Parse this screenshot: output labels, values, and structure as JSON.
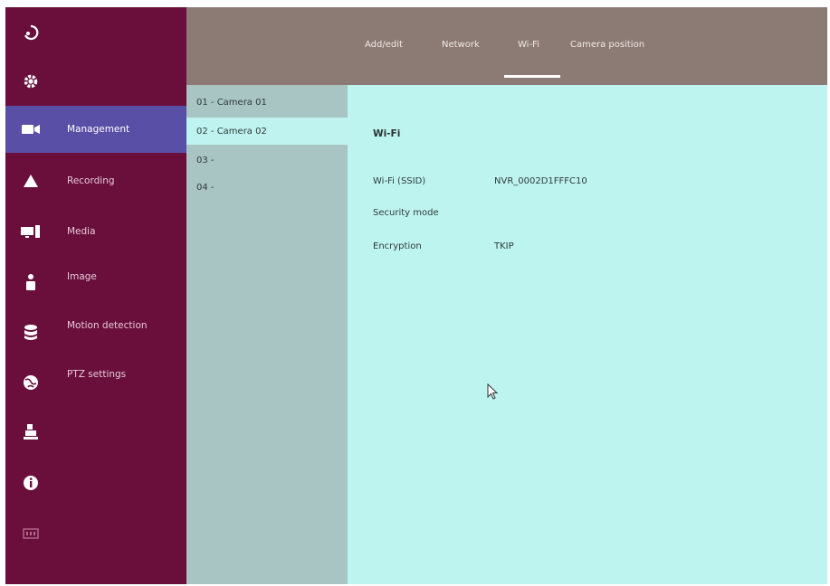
{
  "rail": {
    "icons": [
      "playback-icon",
      "gear-icon",
      "camera-icon",
      "alert-icon",
      "display-devices-icon",
      "person-icon",
      "database-icon",
      "network-globe-icon",
      "printer-icon",
      "info-icon",
      "storage-icon"
    ],
    "active_index": 2
  },
  "menu": {
    "items": [
      {
        "label": "Management",
        "active": true
      },
      {
        "label": "Recording",
        "active": false
      },
      {
        "label": "Media",
        "active": false
      },
      {
        "label": "Image",
        "active": false
      },
      {
        "label": "Motion detection",
        "active": false
      },
      {
        "label": "PTZ settings",
        "active": false
      }
    ]
  },
  "tabs": [
    {
      "label": "Add/edit",
      "active": false
    },
    {
      "label": "Network",
      "active": false
    },
    {
      "label": "Wi-Fi",
      "active": true
    },
    {
      "label": "Camera position",
      "active": false
    }
  ],
  "cameras": [
    {
      "label": "01 - Camera 01",
      "selected": false
    },
    {
      "label": "02 - Camera 02",
      "selected": true
    },
    {
      "label": "03 -",
      "selected": false
    },
    {
      "label": "04 -",
      "selected": false
    }
  ],
  "wifi": {
    "title": "Wi-Fi",
    "fields": [
      {
        "label": "Wi-Fi (SSID)",
        "value": "NVR_0002D1FFFC10"
      },
      {
        "label": "Security mode",
        "value": ""
      },
      {
        "label": "Encryption",
        "value": "TKIP"
      }
    ]
  },
  "colors": {
    "sidebar": "#6a0f3c",
    "active": "#5a4fa6",
    "topbar": "#8c7a74",
    "camlist": "#a8c5c3",
    "content": "#bdf4ef"
  }
}
